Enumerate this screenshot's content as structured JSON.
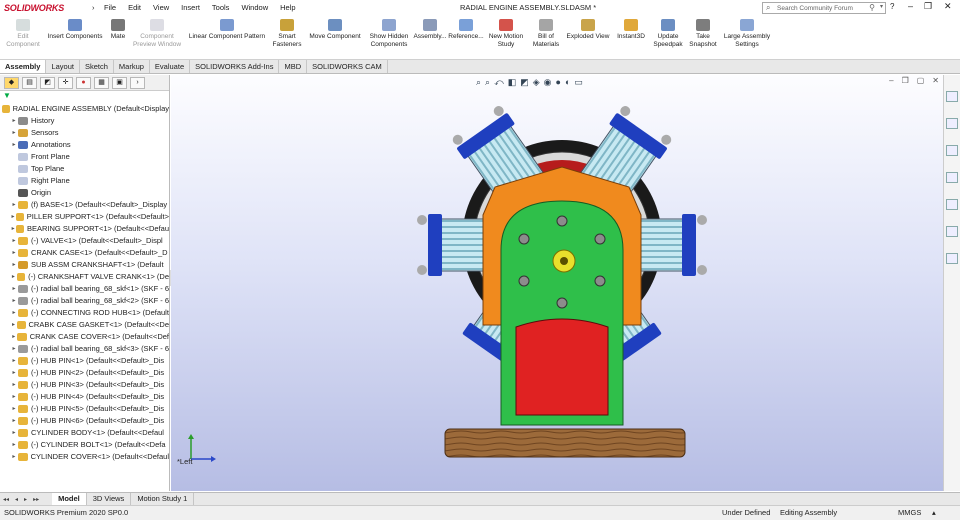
{
  "app": {
    "logo": "SOLIDWORKS",
    "title": "RADIAL ENGINE ASSEMBLY.SLDASM *"
  },
  "menu": [
    "File",
    "Edit",
    "View",
    "Insert",
    "Tools",
    "Window",
    "Help"
  ],
  "search": {
    "placeholder": "Search Community Forum"
  },
  "toolbar": [
    {
      "label": "Edit Component",
      "disabled": true
    },
    {
      "label": "Insert Components",
      "disabled": false
    },
    {
      "label": "Mate",
      "disabled": false
    },
    {
      "label": "Component Preview Window",
      "disabled": true
    },
    {
      "label": "Linear Component Pattern",
      "disabled": false
    },
    {
      "label": "Smart Fasteners",
      "disabled": false
    },
    {
      "label": "Move Component",
      "disabled": false
    },
    {
      "label": "Show Hidden Components",
      "disabled": false
    },
    {
      "label": "Assembly...",
      "disabled": false
    },
    {
      "label": "Reference...",
      "disabled": false
    },
    {
      "label": "New Motion Study",
      "disabled": false
    },
    {
      "label": "Bill of Materials",
      "disabled": false
    },
    {
      "label": "Exploded View",
      "disabled": false
    },
    {
      "label": "Instant3D",
      "disabled": false
    },
    {
      "label": "Update Speedpak",
      "disabled": false
    },
    {
      "label": "Take Snapshot",
      "disabled": false
    },
    {
      "label": "Large Assembly Settings",
      "disabled": false
    }
  ],
  "command_tabs": [
    "Assembly",
    "Layout",
    "Sketch",
    "Markup",
    "Evaluate",
    "SOLIDWORKS Add-Ins",
    "MBD",
    "SOLIDWORKS CAM"
  ],
  "tree": {
    "root": "RADIAL ENGINE ASSEMBLY  (Default<Display",
    "items": [
      {
        "label": "History",
        "icon": "history-icon"
      },
      {
        "label": "Sensors",
        "icon": "sensor-icon"
      },
      {
        "label": "Annotations",
        "icon": "annotation-icon"
      },
      {
        "label": "Front Plane",
        "icon": "plane-icon"
      },
      {
        "label": "Top Plane",
        "icon": "plane-icon"
      },
      {
        "label": "Right Plane",
        "icon": "plane-icon"
      },
      {
        "label": "Origin",
        "icon": "origin-icon"
      },
      {
        "label": "(f) BASE<1> (Default<<Default>_Display",
        "icon": "part-icon"
      },
      {
        "label": "PILLER SUPPORT<1> (Default<<Default>",
        "icon": "part-icon"
      },
      {
        "label": "BEARING SUPPORT<1> (Default<<Defau",
        "icon": "part-icon"
      },
      {
        "label": "(-) VALVE<1> (Default<<Default>_Displ",
        "icon": "part-icon"
      },
      {
        "label": "CRANK CASE<1> (Default<<Default>_D",
        "icon": "part-icon"
      },
      {
        "label": "SUB ASSM CRANKSHAFT<1> (Default",
        "icon": "subassembly-icon"
      },
      {
        "label": "(-) CRANKSHAFT VALVE CRANK<1> (De",
        "icon": "part-icon"
      },
      {
        "label": "(-) radial ball bearing_68_skf<1> (SKF - 6",
        "icon": "toolbox-icon"
      },
      {
        "label": "(-) radial ball bearing_68_skf<2> (SKF - 6",
        "icon": "toolbox-icon"
      },
      {
        "label": "(-) CONNECTING ROD HUB<1> (Default",
        "icon": "part-icon"
      },
      {
        "label": "CRABK CASE GASKET<1> (Default<<De",
        "icon": "part-icon"
      },
      {
        "label": "CRANK CASE COVER<1> (Default<<Def",
        "icon": "part-icon"
      },
      {
        "label": "(-) radial ball bearing_68_skf<3> (SKF - 6",
        "icon": "toolbox-icon"
      },
      {
        "label": "(-) HUB PIN<1> (Default<<Default>_Dis",
        "icon": "part-icon"
      },
      {
        "label": "(-) HUB PIN<2> (Default<<Default>_Dis",
        "icon": "part-icon"
      },
      {
        "label": "(-) HUB PIN<3> (Default<<Default>_Dis",
        "icon": "part-icon"
      },
      {
        "label": "(-) HUB PIN<4> (Default<<Default>_Dis",
        "icon": "part-icon"
      },
      {
        "label": "(-) HUB PIN<5> (Default<<Default>_Dis",
        "icon": "part-icon"
      },
      {
        "label": "(-) HUB PIN<6> (Default<<Default>_Dis",
        "icon": "part-icon"
      },
      {
        "label": "CYLINDER BODY<1> (Default<<Defaul",
        "icon": "part-icon"
      },
      {
        "label": "(-) CYLINDER BOLT<1> (Default<<Defa",
        "icon": "part-icon"
      },
      {
        "label": "CYLINDER COVER<1> (Default<<Defaul",
        "icon": "part-icon"
      }
    ]
  },
  "view_label": "*Left",
  "bottom_tabs": [
    "Model",
    "3D Views",
    "Motion Study 1"
  ],
  "status": {
    "product": "SOLIDWORKS Premium 2020 SP0.0",
    "state": "Under Defined",
    "mode": "Editing Assembly",
    "units": "MMGS"
  },
  "colors": {
    "accent": "#c8102e",
    "base": "#8b5a2b",
    "crankcase": "#2fbf4a",
    "cover": "#f08a1e",
    "cylinder_fin": "#b9e3ee",
    "cylinder_head": "#1f3fbf"
  }
}
